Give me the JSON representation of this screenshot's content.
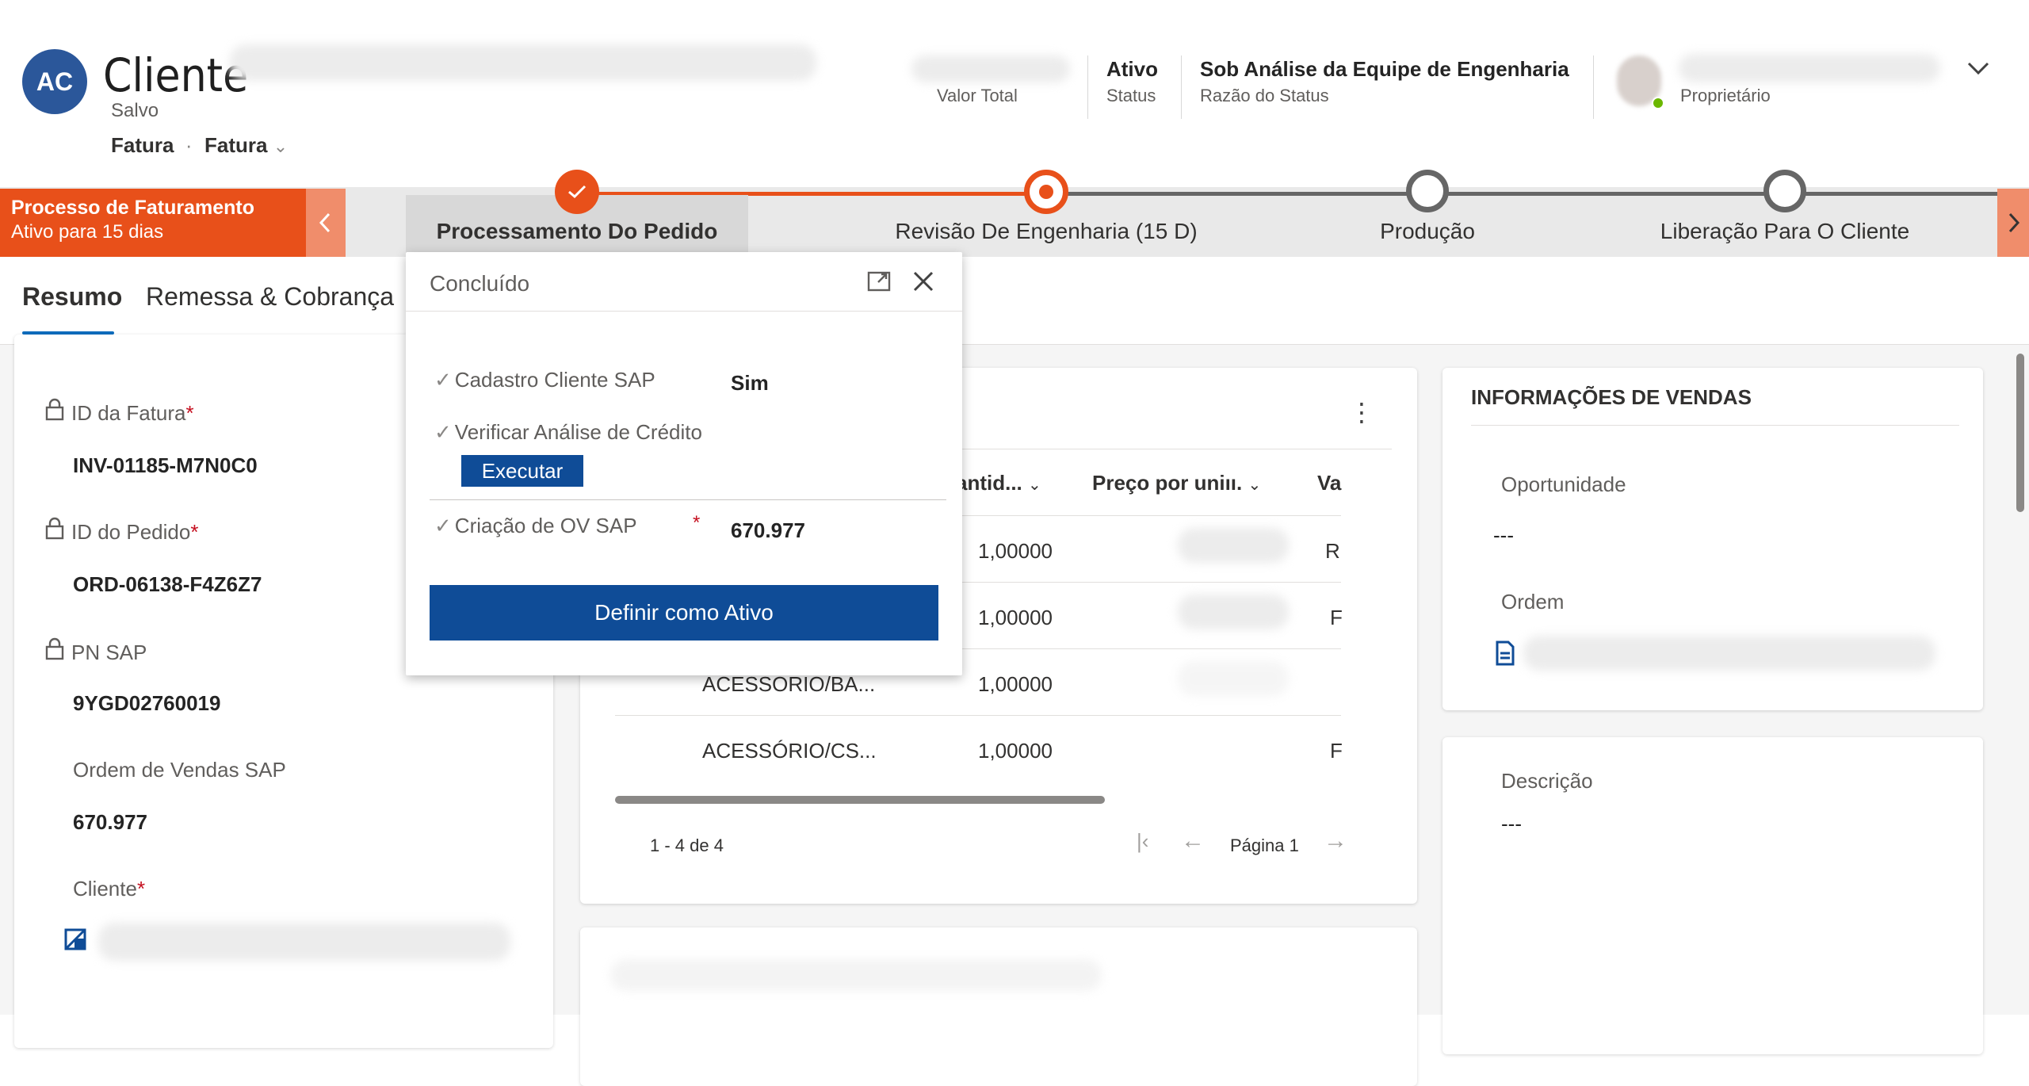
{
  "header": {
    "avatar_initials": "AC",
    "title": "Cliente",
    "save_status": "Salvo",
    "entity": "Fatura",
    "form_selector": "Fatura",
    "value_total_label": "Valor Total",
    "status_value": "Ativo",
    "status_label": "Status",
    "reason_value": "Sob Análise da Equipe de Engenharia",
    "reason_label": "Razão do Status",
    "owner_label": "Proprietário"
  },
  "bpf": {
    "process_name": "Processo de Faturamento",
    "process_duration": "Ativo para 15 dias",
    "stages": [
      {
        "label": "Processamento Do Pedido",
        "state": "completed"
      },
      {
        "label": "Revisão De Engenharia  (15 D)",
        "state": "active"
      },
      {
        "label": "Produção",
        "state": "inactive"
      },
      {
        "label": "Liberação Para O Cliente",
        "state": "inactive"
      }
    ]
  },
  "flyout": {
    "title": "Concluído",
    "steps": [
      {
        "label": "Cadastro Cliente SAP",
        "value": "Sim"
      },
      {
        "label": "Verificar Análise de Crédito",
        "action": "Executar"
      },
      {
        "label": "Criação de OV SAP",
        "required_mark": "*",
        "value": "670.977"
      }
    ],
    "set_active_button": "Definir como Ativo"
  },
  "tabs": [
    {
      "label": "Resumo",
      "selected": true
    },
    {
      "label": "Remessa & Cobrança",
      "selected": false
    }
  ],
  "summary_fields": [
    {
      "label": "ID da Fatura",
      "required": "*",
      "value": "INV-01185-M7N0C0"
    },
    {
      "label": "ID do Pedido",
      "required": "*",
      "value": "ORD-06138-F4Z6Z7"
    },
    {
      "label": "PN SAP",
      "value": "9YGD02760019"
    },
    {
      "label": "Ordem de Vendas SAP",
      "value": "670.977"
    },
    {
      "label": "Cliente",
      "required": "*"
    }
  ],
  "products_grid": {
    "columns": [
      "antid...",
      "Preço por uniıı.",
      "Va"
    ],
    "rows": [
      {
        "name": "",
        "qty": "1,00000",
        "tail": "R"
      },
      {
        "name": "",
        "qty": "1,00000",
        "tail": "F"
      },
      {
        "name": "ACESSORIO/BA...",
        "qty": "1,00000",
        "tail": ""
      },
      {
        "name": "ACESSÓRIO/CS...",
        "qty": "1,00000",
        "tail": "F"
      }
    ],
    "record_count": "1 - 4 de 4",
    "page_label": "Página 1"
  },
  "sales_info": {
    "title": "INFORMAÇÕES DE VENDAS",
    "opportunity_label": "Oportunidade",
    "opportunity_value": "---",
    "order_label": "Ordem"
  },
  "description": {
    "label": "Descrição",
    "value": "---"
  },
  "colors": {
    "accent_orange": "#e8501a",
    "brand_blue": "#0f4c97",
    "avatar_blue": "#2b579a",
    "stage_inactive": "#666666"
  }
}
